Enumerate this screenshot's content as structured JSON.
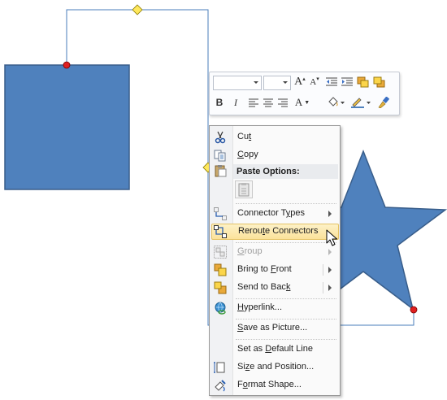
{
  "mini_toolbar": {
    "font_name": "",
    "font_size": "",
    "grow_font": "A",
    "shrink_font": "A",
    "bold": "B",
    "italic": "I",
    "font_color": "A"
  },
  "menu": {
    "cut": {
      "before": "Cu",
      "key": "t",
      "after": ""
    },
    "copy": {
      "before": "",
      "key": "C",
      "after": "opy"
    },
    "paste_header": "Paste Options:",
    "connector_types": {
      "before": "Connector T",
      "key": "y",
      "after": "pes"
    },
    "reroute": {
      "before": "Rerou",
      "key": "t",
      "after": "e Connectors"
    },
    "group": {
      "before": "",
      "key": "G",
      "after": "roup"
    },
    "bring_to_front": {
      "before": "Bring to ",
      "key": "F",
      "after": "ront"
    },
    "send_to_back": {
      "before": "Send to Bac",
      "key": "k",
      "after": ""
    },
    "hyperlink": {
      "before": "",
      "key": "H",
      "after": "yperlink..."
    },
    "save_as_picture": {
      "before": "",
      "key": "S",
      "after": "ave as Picture..."
    },
    "default_line": {
      "before": "Set as ",
      "key": "D",
      "after": "efault Line"
    },
    "size_position": {
      "before": "Si",
      "key": "z",
      "after": "e and Position..."
    },
    "format_shape": {
      "before": "F",
      "key": "o",
      "after": "rmat Shape..."
    }
  },
  "colors": {
    "shape_fill": "#4f81bd",
    "shape_stroke": "#385d8a",
    "connector": "#4a7ebb",
    "highlight": "#fbe29a",
    "handle_yellow": "#ffe85c",
    "handle_red": "#e02020"
  },
  "icons": [
    "scissors-icon",
    "copy-icon",
    "paste-icon",
    "paste-keep-icon",
    "connector-types-icon",
    "reroute-connectors-icon",
    "group-icon",
    "bring-to-front-icon",
    "send-to-back-icon",
    "hyperlink-icon",
    "size-position-icon",
    "format-shape-icon",
    "mouse-pointer-icon"
  ]
}
